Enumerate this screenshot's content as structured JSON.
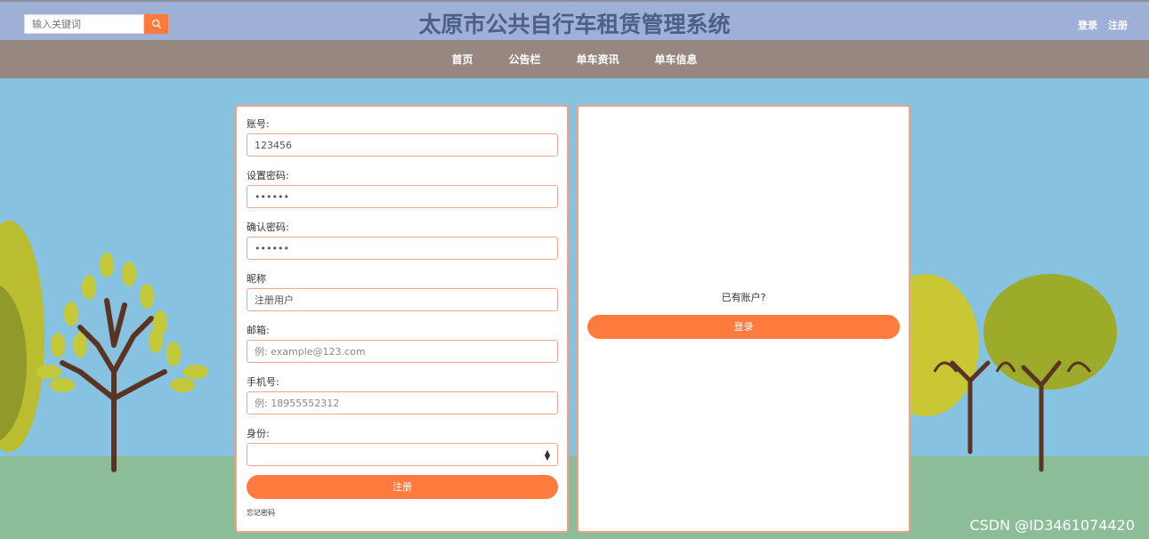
{
  "header": {
    "search_placeholder": "输入关键词",
    "title": "太原市公共自行车租赁管理系统",
    "login_link": "登录",
    "register_link": "注册"
  },
  "nav": {
    "items": [
      {
        "label": "首页"
      },
      {
        "label": "公告栏"
      },
      {
        "label": "单车资讯"
      },
      {
        "label": "单车信息"
      }
    ]
  },
  "form": {
    "account_label": "账号:",
    "account_value": "123456",
    "password_label": "设置密码:",
    "password_value": "123456",
    "confirm_label": "确认密码:",
    "confirm_value": "123456",
    "nickname_label": "昵称",
    "nickname_value": "注册用户",
    "email_label": "邮箱:",
    "email_placeholder": "例: example@123.com",
    "phone_label": "手机号:",
    "phone_placeholder": "例: 18955552312",
    "identity_label": "身份:",
    "identity_value": "",
    "register_button": "注册",
    "forgot_link": "忘记密码"
  },
  "side": {
    "have_account": "已有账户?",
    "login_button": "登录"
  },
  "watermark": "CSDN @ID3461074420",
  "colors": {
    "accent": "#ff7a3d",
    "header_bg": "#9fb0d6",
    "nav_bg": "#968880",
    "sky": "#87c3e0",
    "ground": "#8bbd98",
    "card_border": "#f2a082"
  }
}
